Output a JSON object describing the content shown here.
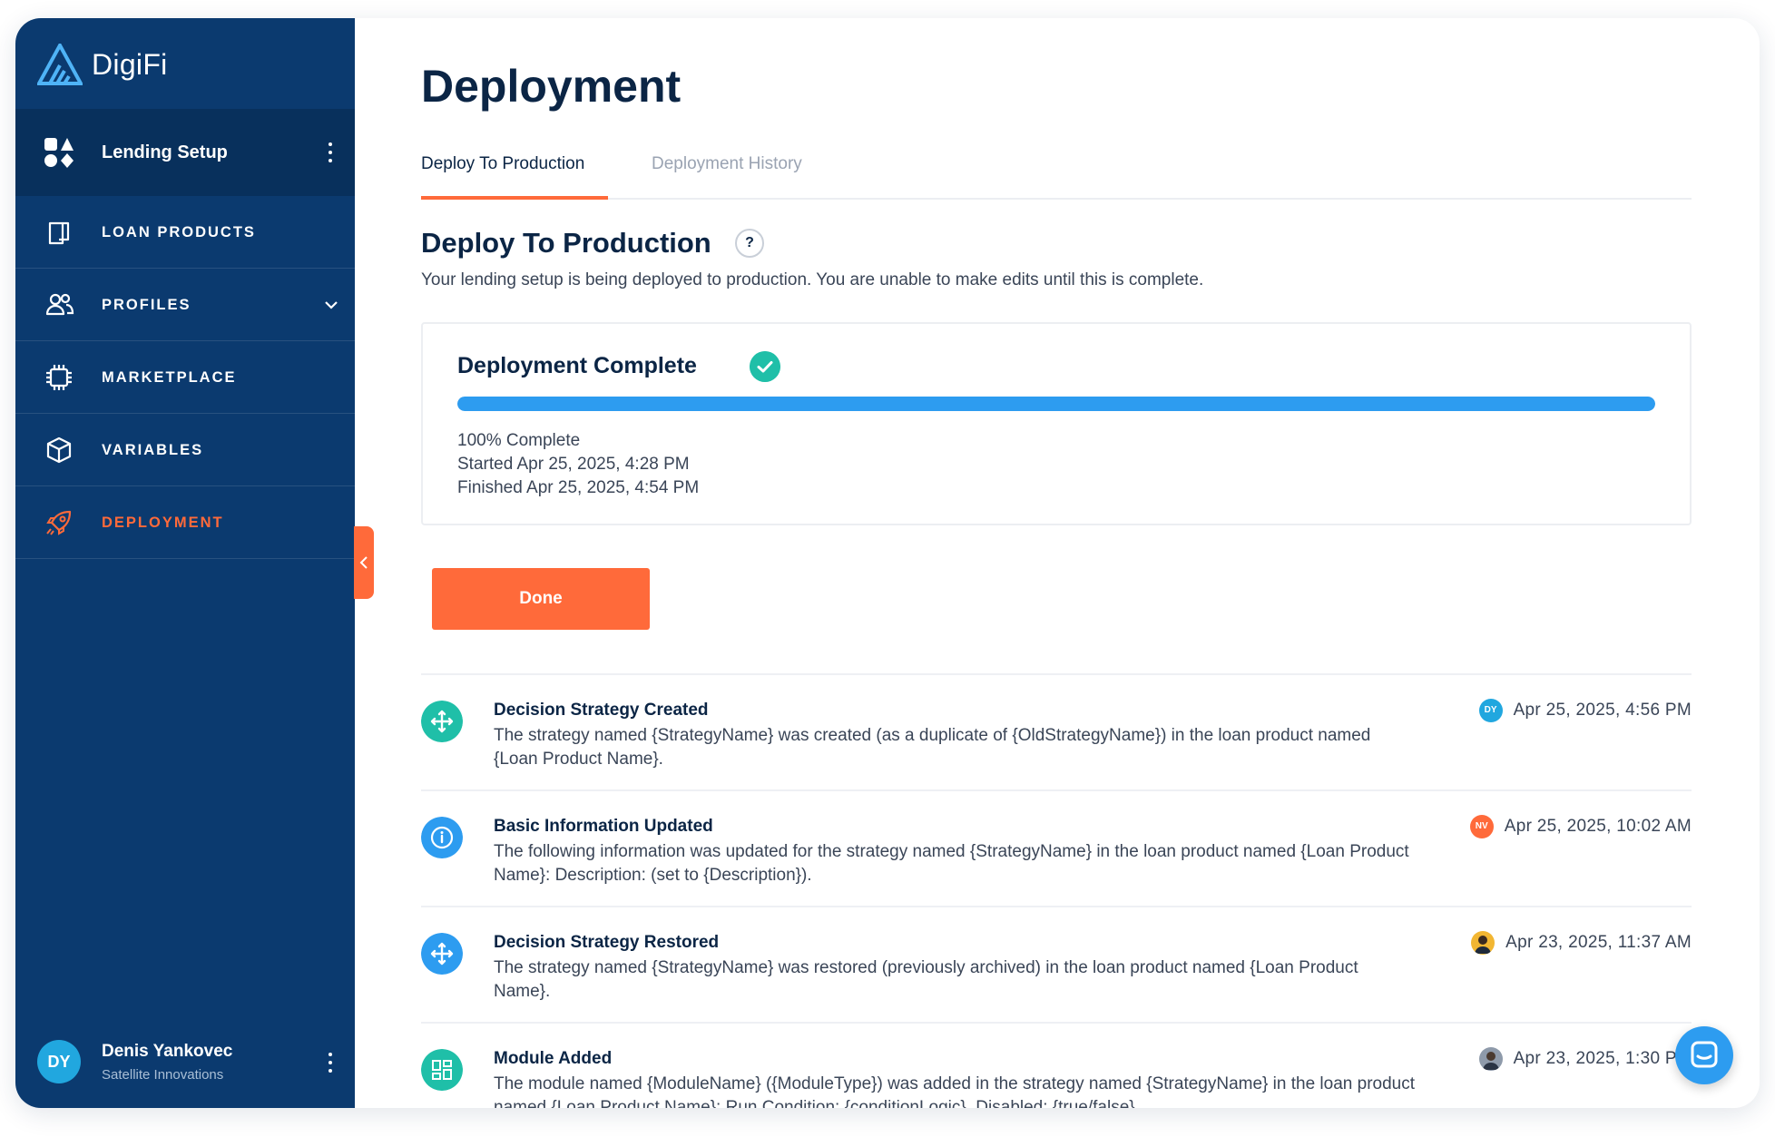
{
  "app": {
    "logo_text": "DigiFi"
  },
  "sidebar": {
    "setup_label": "Lending Setup",
    "items": [
      {
        "label": "LOAN PRODUCTS",
        "icon": "book-icon"
      },
      {
        "label": "PROFILES",
        "icon": "users-icon"
      },
      {
        "label": "MARKETPLACE",
        "icon": "chip-icon"
      },
      {
        "label": "VARIABLES",
        "icon": "cube-icon"
      },
      {
        "label": "DEPLOYMENT",
        "icon": "rocket-icon"
      }
    ],
    "user": {
      "initials": "DY",
      "name": "Denis Yankovec",
      "org": "Satellite Innovations"
    }
  },
  "main": {
    "title": "Deployment",
    "tabs": [
      {
        "label": "Deploy To Production"
      },
      {
        "label": "Deployment History"
      }
    ],
    "section_title": "Deploy To Production",
    "help_label": "?",
    "section_desc": "Your lending setup is being deployed to production. You are unable to make edits until this is complete.",
    "status": {
      "title": "Deployment Complete",
      "progress_fraction": 1.0,
      "percent_text": "100% Complete",
      "started_text": "Started Apr 25, 2025, 4:28 PM",
      "finished_text": "Finished Apr 25, 2025, 4:54 PM"
    },
    "done_label": "Done",
    "feed": [
      {
        "title": "Decision Strategy Created",
        "body": "The strategy named {StrategyName} was created (as a duplicate of {OldStrategyName}) in the loan product named {Loan Product Name}.",
        "avatar_initials": "DY",
        "time": "Apr 25, 2025, 4:56 PM"
      },
      {
        "title": "Basic Information Updated",
        "body": "The following information was updated for the strategy named {StrategyName} in the loan product named {Loan Product Name}: Description: (set to {Description}).",
        "avatar_initials": "NV",
        "time": "Apr 25, 2025, 10:02 AM"
      },
      {
        "title": "Decision Strategy Restored",
        "body": "The strategy named {StrategyName} was restored (previously archived) in the loan product named {Loan Product Name}.",
        "avatar_initials": "",
        "time": "Apr 23, 2025, 11:37 AM"
      },
      {
        "title": "Module Added",
        "body": "The module named {ModuleName} ({ModuleType}) was added in the strategy named {StrategyName} in the loan product named {Loan Product Name}: Run Condition: {conditionLogic}, Disabled: {true/false}.",
        "avatar_initials": "",
        "time": "Apr 23, 2025, 1:30 PM"
      }
    ]
  },
  "colors": {
    "sidebar_bg": "#0b3a6f",
    "accent": "#ff6a3a",
    "progress": "#2d9cf0",
    "success": "#1fbfa8",
    "heading": "#0b2545"
  }
}
